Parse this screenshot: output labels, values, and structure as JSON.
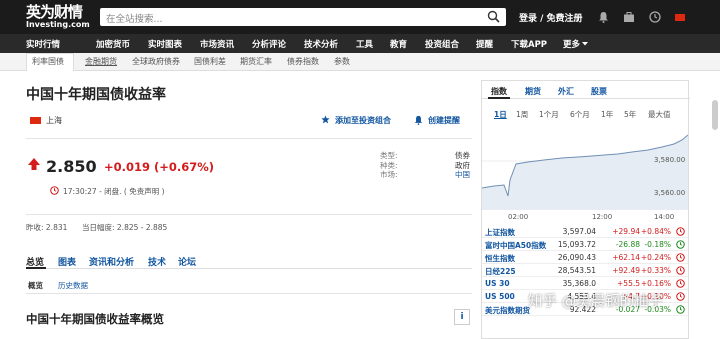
{
  "header": {
    "logo_cn": "英为财情",
    "logo_en": "Investing.com",
    "search_placeholder": "在全站搜索...",
    "login": "登录 / 免费注册"
  },
  "nav": {
    "items": [
      "实时行情",
      "加密货币",
      "实时图表",
      "市场资讯",
      "分析评论",
      "技术分析",
      "工具",
      "教育",
      "投资组合",
      "提醒",
      "下载APP",
      "更多"
    ]
  },
  "subnav": {
    "items": [
      "利率国债",
      "金融期货",
      "全球政府债券",
      "国债利差",
      "期货汇率",
      "债券指数",
      "参数"
    ]
  },
  "instrument": {
    "title": "中国十年期国债收益率",
    "location": "上海",
    "add_portfolio": "添加至投资组合",
    "create_alert": "创建提醒",
    "price": "2.850",
    "change": "+0.019 (+0.67%)",
    "time_line": "17:30:27 - 闭盘. ( 免责声明 )",
    "meta_labels": [
      "类型:",
      "种类:",
      "市场:"
    ],
    "meta_values": [
      "债券",
      "政府",
      "中国"
    ],
    "prev_close": "昨收: 2.831",
    "day_range": "当日幅度: 2.825 - 2.885"
  },
  "tabs": {
    "main": [
      "总览",
      "图表",
      "资讯和分析",
      "技术",
      "论坛"
    ],
    "sub": [
      "概览",
      "历史数据"
    ]
  },
  "section_title": "中国十年期国债收益率概览",
  "right_panel": {
    "tabs": [
      "指数",
      "期货",
      "外汇",
      "股票"
    ],
    "ranges": [
      "1日",
      "1周",
      "1个月",
      "6个月",
      "1年",
      "5年",
      "最大值"
    ],
    "chart_y_ticks": [
      "3,580.00",
      "3,560.00"
    ],
    "chart_x_ticks": [
      "02:00",
      "12:00",
      "14:00"
    ],
    "quotes": [
      {
        "name": "上证指数",
        "price": "3,597.04",
        "change": "+29.94",
        "pct": "+0.84%",
        "dir": "pos"
      },
      {
        "name": "富时中国A50指数",
        "price": "15,093.72",
        "change": "-26.88",
        "pct": "-0.18%",
        "dir": "neg"
      },
      {
        "name": "恒生指数",
        "price": "26,090.43",
        "change": "+62.14",
        "pct": "+0.24%",
        "dir": "pos"
      },
      {
        "name": "日经225",
        "price": "28,543.51",
        "change": "+92.49",
        "pct": "+0.33%",
        "dir": "pos"
      },
      {
        "name": "US 30",
        "price": "35,368.0",
        "change": "+55.5",
        "pct": "+0.16%",
        "dir": "pos"
      },
      {
        "name": "US 500",
        "price": "4,553.4",
        "change": "+4.7",
        "pct": "+0.10%",
        "dir": "pos"
      },
      {
        "name": "美元指数期货",
        "price": "92.422",
        "change": "-0.027",
        "pct": "-0.03%",
        "dir": "neg"
      }
    ]
  },
  "watermark": "知乎 @吴晨钢的柚子"
}
